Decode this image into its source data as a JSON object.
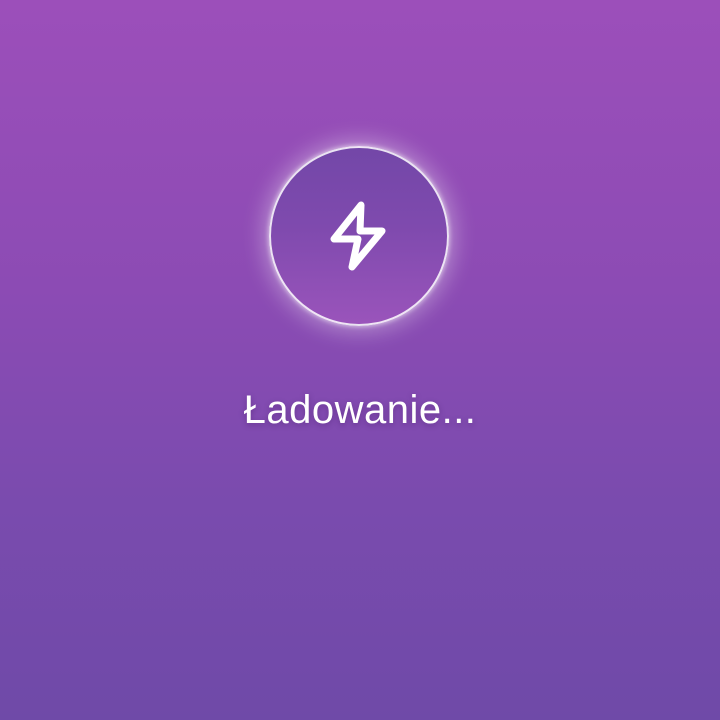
{
  "loading": {
    "icon": "lightning-bolt-icon",
    "text": "Ładowanie..."
  },
  "colors": {
    "background_top": "#9c4fba",
    "background_bottom": "#6f4aa8",
    "icon_stroke": "#ffffff",
    "text": "#ffffff"
  }
}
